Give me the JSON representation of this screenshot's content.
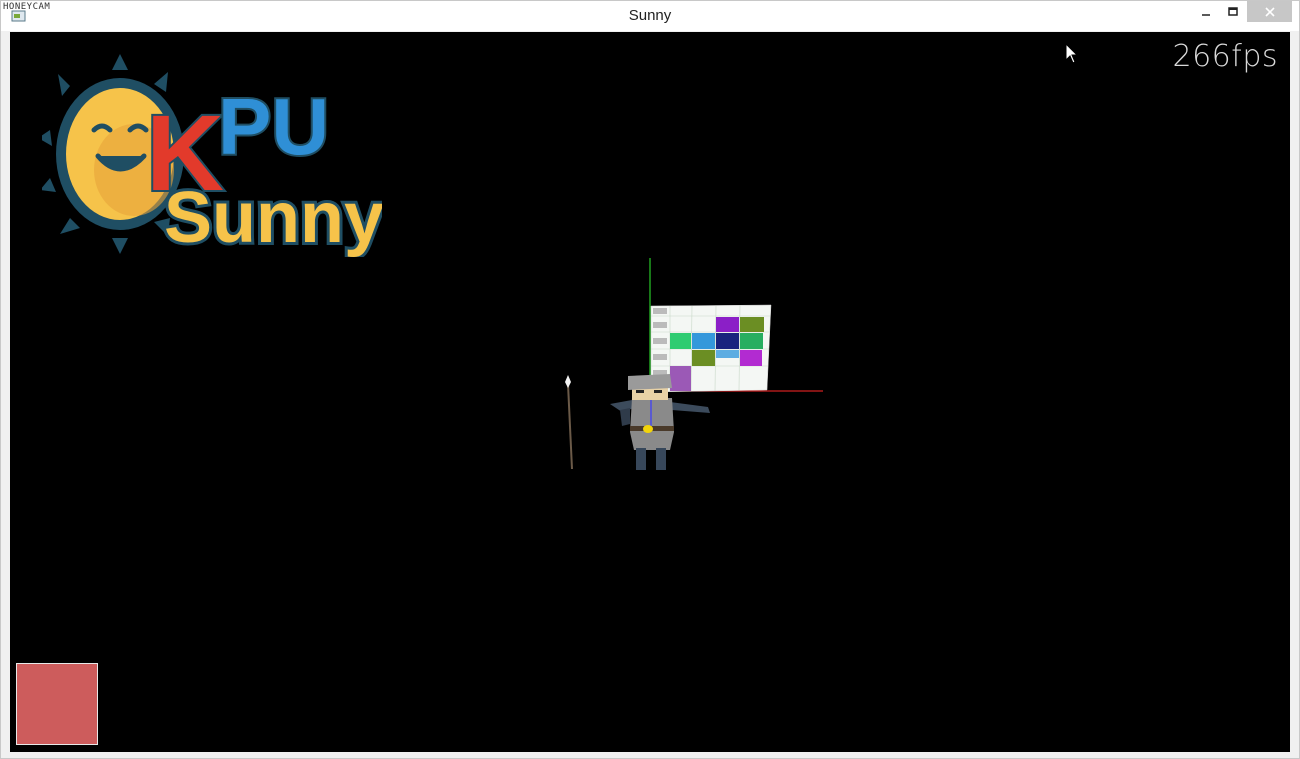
{
  "window": {
    "title": "Sunny",
    "watermark": "HONEYCAM",
    "minimize_label": "–",
    "close_label": "✕"
  },
  "hud": {
    "fps": "266fps"
  },
  "logo": {
    "kpu_text": "KPU",
    "game_name": "Sunny",
    "colors": {
      "sun": "#f6c34a",
      "sun_outline": "#1f4e63",
      "k": "#e23a2b",
      "pu": "#2f8fd6",
      "sunny_text": "#f6c34a"
    }
  },
  "scene": {
    "axis_colors": {
      "y": "#28c828",
      "x": "#d02020",
      "z": "#3a3aff"
    },
    "timetable_colors": [
      "#8b1fc7",
      "#6b8e23",
      "#27ae60",
      "#2ecc71",
      "#3498db",
      "#1a237e",
      "#5dade2",
      "#9b59b6",
      "#b22bd1"
    ]
  },
  "health_indicator": {
    "color": "#cd5c5c"
  }
}
